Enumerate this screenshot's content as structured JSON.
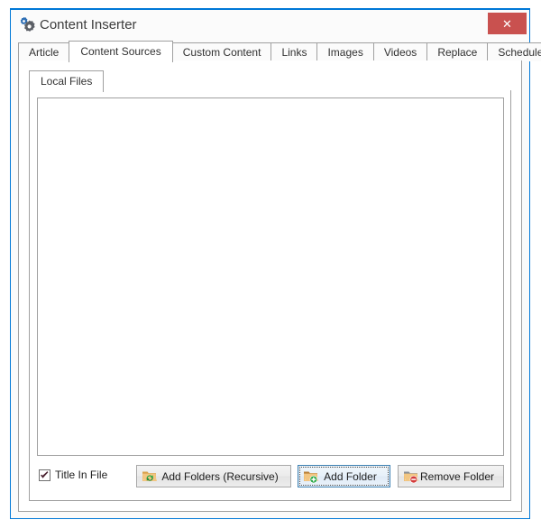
{
  "window": {
    "title": "Content Inserter",
    "icon": "gears-icon",
    "close_label": "✕",
    "accent_color": "#0078d7",
    "close_button_color": "#c9514f"
  },
  "tabs": [
    {
      "label": "Article",
      "selected": false
    },
    {
      "label": "Content Sources",
      "selected": true
    },
    {
      "label": "Custom Content",
      "selected": false
    },
    {
      "label": "Links",
      "selected": false
    },
    {
      "label": "Images",
      "selected": false
    },
    {
      "label": "Videos",
      "selected": false
    },
    {
      "label": "Replace",
      "selected": false
    },
    {
      "label": "Schedule",
      "selected": false
    }
  ],
  "inner_tabs": [
    {
      "label": "Local Files",
      "selected": true
    }
  ],
  "file_list": {
    "items": [],
    "empty": true
  },
  "action_bar": {
    "title_in_file": {
      "label": "Title In File",
      "checked": true
    },
    "buttons": [
      {
        "id": "add-folders-recursive",
        "label": "Add Folders (Recursive)",
        "icon": "folder-recursive-icon",
        "focused": false
      },
      {
        "id": "add-folder",
        "label": "Add Folder",
        "icon": "folder-add-icon",
        "focused": true
      },
      {
        "id": "remove-folder",
        "label": "Remove Folder",
        "icon": "folder-remove-icon",
        "focused": false
      }
    ]
  }
}
